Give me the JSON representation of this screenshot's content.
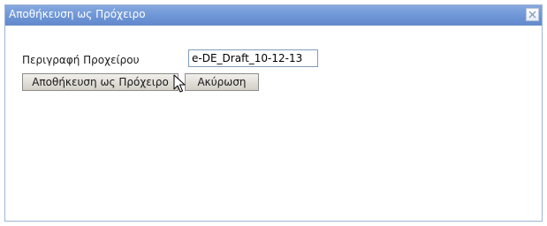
{
  "dialog": {
    "title": "Αποθήκευση ως Πρόχειρο",
    "close_icon": "close-icon"
  },
  "form": {
    "description_label": "Περιγραφή Προχείρου",
    "description_value": "e-DE_Draft_10-12-13"
  },
  "buttons": {
    "save_label": "Αποθήκευση ως Πρόχειρο",
    "cancel_label": "Ακύρωση"
  },
  "colors": {
    "titlebar": "#7098d8",
    "title_text": "#ffffff"
  },
  "cursor_icon": "mouse-pointer-icon"
}
